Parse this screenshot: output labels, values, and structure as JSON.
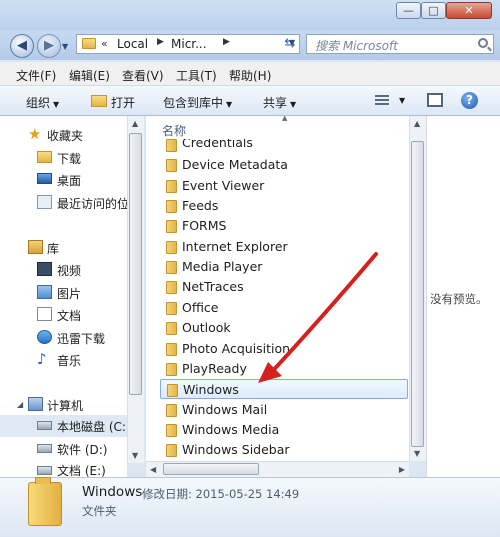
{
  "window": {
    "minimize": "—",
    "maximize": "□",
    "close": "✕"
  },
  "address": {
    "chevron": "«",
    "crumbs": [
      "Local",
      "Micr..."
    ],
    "search_placeholder": "搜索 Microsoft"
  },
  "menu": [
    "文件(F)",
    "编辑(E)",
    "查看(V)",
    "工具(T)",
    "帮助(H)"
  ],
  "toolbar": {
    "organize": "组织",
    "open": "打开",
    "include": "包含到库中",
    "share": "共享"
  },
  "nav": {
    "favorites": "收藏夹",
    "downloads": "下载",
    "desktop": "桌面",
    "recent": "最近访问的位",
    "library": "库",
    "videos": "视频",
    "pictures": "图片",
    "documents": "文档",
    "thunder": "迅雷下载",
    "music": "音乐",
    "computer": "计算机",
    "local_disk": "本地磁盘 (C:)",
    "software": "软件 (D:)",
    "docs_drive": "文档 (E:)"
  },
  "files": {
    "column_header": "名称",
    "items": [
      "Credentials",
      "Device Metadata",
      "Event Viewer",
      "Feeds",
      "FORMS",
      "Internet Explorer",
      "Media Player",
      "NetTraces",
      "Office",
      "Outlook",
      "Photo Acquisition",
      "PlayReady",
      "Windows",
      "Windows Mail",
      "Windows Media",
      "Windows Sidebar"
    ],
    "selected": "Windows"
  },
  "preview": {
    "empty_text": "没有预览。"
  },
  "details": {
    "name": "Windows",
    "modified": "修改日期: 2015-05-25 14:49",
    "type": "文件夹"
  },
  "colors": {
    "selection_border": "#84acdd",
    "annotation_arrow": "#d6201e"
  }
}
